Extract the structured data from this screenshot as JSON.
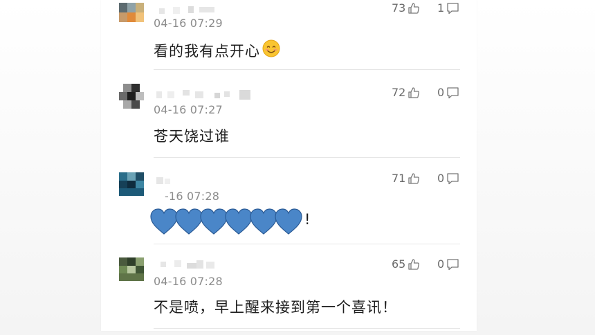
{
  "colors": {
    "heart": "#4a86c8",
    "heart_edge": "#2a5a95",
    "muted": "#8c8c8c",
    "text": "#1e1e1e"
  },
  "icons": {
    "like": "thumbs-up-icon",
    "reply": "speech-bubble-icon",
    "emoji": "smiling-face-icon",
    "heart": "blue-heart-icon"
  },
  "comments": [
    {
      "time": "04-16 07:29",
      "text": "看的我有点开心",
      "likes": "73",
      "replies": "1"
    },
    {
      "time": "04-16 07:27",
      "text": "苍天饶过谁",
      "likes": "72",
      "replies": "0"
    },
    {
      "time": "-16 07:28",
      "text": "!",
      "likes": "71",
      "replies": "0"
    },
    {
      "time": "04-16 07:28",
      "text": "不是喷，早上醒来接到第一个喜讯！",
      "likes": "65",
      "replies": "0"
    }
  ]
}
